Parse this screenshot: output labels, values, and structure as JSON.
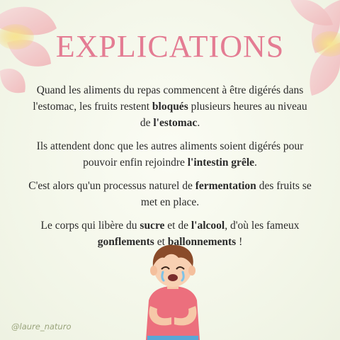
{
  "title": "EXPLICATIONS",
  "paragraphs": [
    {
      "segments": [
        {
          "text": "Quand les aliments  du repas commencent à être digérés dans l'estomac, les fruits restent ",
          "bold": false
        },
        {
          "text": "bloqués",
          "bold": true
        },
        {
          "text": " plusieurs heures au niveau de ",
          "bold": false
        },
        {
          "text": "l'estomac",
          "bold": true
        },
        {
          "text": ".",
          "bold": false
        }
      ]
    },
    {
      "segments": [
        {
          "text": "Ils attendent donc que les autres aliments soient digérés pour pouvoir enfin rejoindre ",
          "bold": false
        },
        {
          "text": "l'intestin grêle",
          "bold": true
        },
        {
          "text": ".",
          "bold": false
        }
      ]
    },
    {
      "segments": [
        {
          "text": "C'est alors qu'un processus naturel de ",
          "bold": false
        },
        {
          "text": "fermentation",
          "bold": true
        },
        {
          "text": " des fruits se met en place.",
          "bold": false
        }
      ]
    },
    {
      "segments": [
        {
          "text": "Le corps qui libère du ",
          "bold": false
        },
        {
          "text": "sucre",
          "bold": true
        },
        {
          "text": " et de ",
          "bold": false
        },
        {
          "text": "l'alcool",
          "bold": true
        },
        {
          "text": ", d'où les fameux ",
          "bold": false
        },
        {
          "text": "gonflements",
          "bold": true
        },
        {
          "text": " et ",
          "bold": false
        },
        {
          "text": "ballonnements",
          "bold": true
        },
        {
          "text": " !",
          "bold": false
        }
      ]
    }
  ],
  "handle": "@laure_naturo",
  "icons": {
    "petals": "flower-petals-icon",
    "illustration": "crying-child-holding-stomach-icon"
  },
  "colors": {
    "title": "#e47c93",
    "petal_pink": "#f3c2c4",
    "petal_yellow": "#f7dc7a",
    "handle": "#9aa47c",
    "shirt": "#ec6f7d"
  }
}
